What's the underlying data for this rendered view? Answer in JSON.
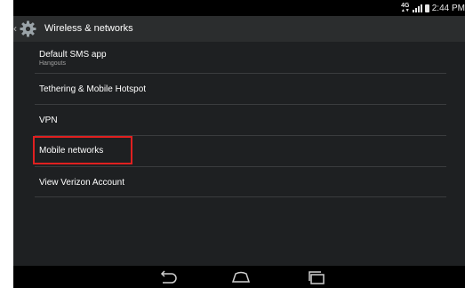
{
  "status_bar": {
    "network": "4G LTE",
    "time": "2:44 PM"
  },
  "action_bar": {
    "title": "Wireless & networks",
    "icon": "gear-icon"
  },
  "items": [
    {
      "title": "Default SMS app",
      "subtitle": "Hangouts"
    },
    {
      "title": "Tethering & Mobile Hotspot"
    },
    {
      "title": "VPN"
    },
    {
      "title": "Mobile networks"
    },
    {
      "title": "View Verizon Account"
    }
  ],
  "nav_bar": {
    "buttons": [
      "back-icon",
      "home-icon",
      "recents-icon"
    ]
  },
  "colors": {
    "background": "#1e2022",
    "action_bar": "#2b2d2e",
    "highlight": "#e02020",
    "text": "#ffffff",
    "subtext": "#a0a0a0"
  }
}
